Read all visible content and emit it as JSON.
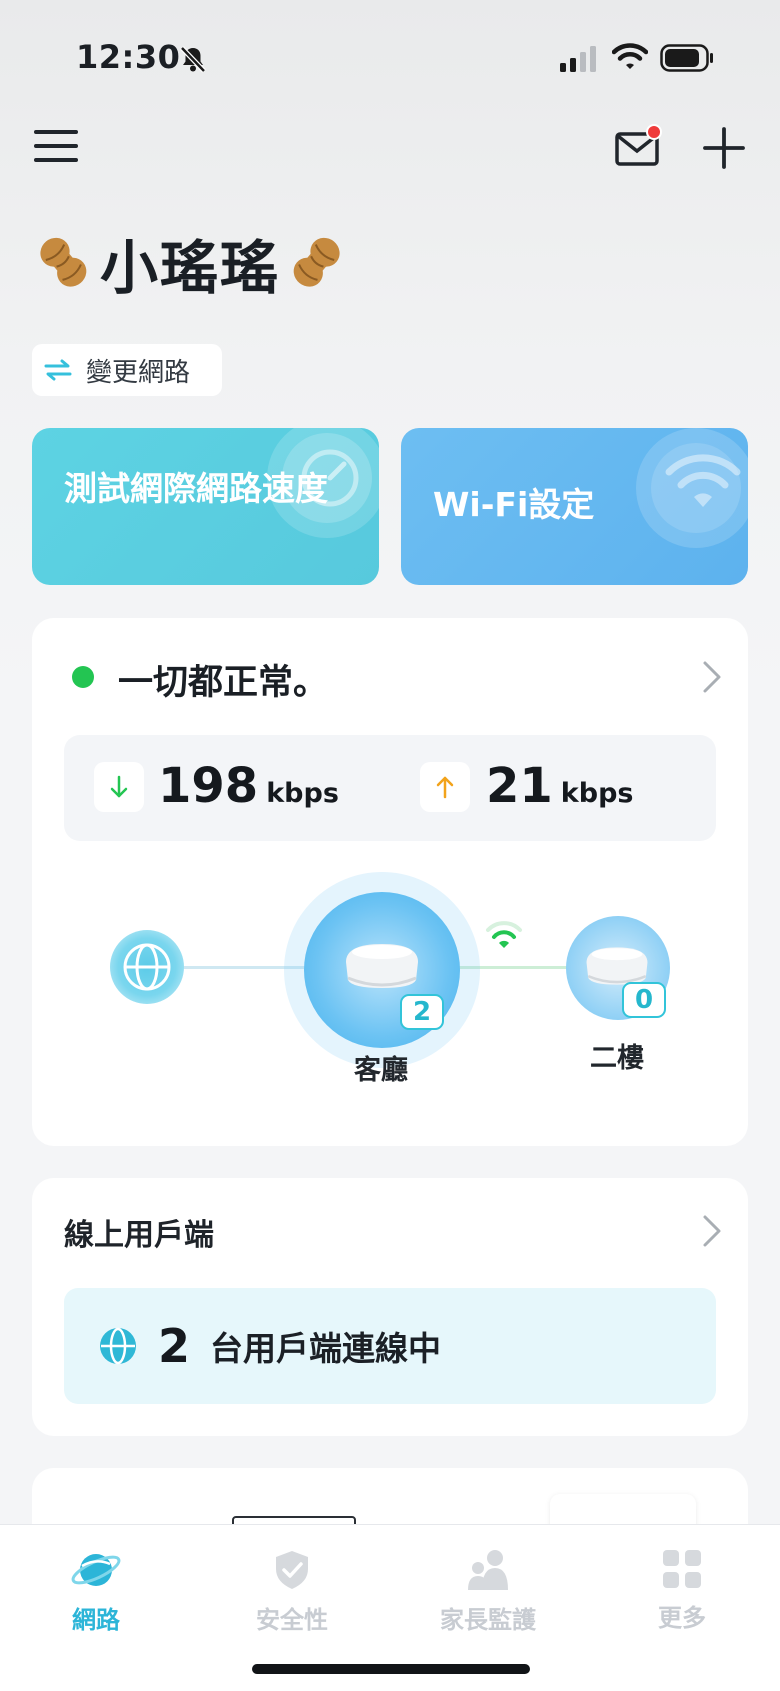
{
  "status_bar": {
    "time": "12:30"
  },
  "header": {
    "title": "小瑤瑤",
    "title_emoji": "🥜"
  },
  "change_network": {
    "label": "變更網路"
  },
  "action_cards": {
    "speed_test": {
      "label": "測試網際網路速度",
      "color": "#5dd3e3"
    },
    "wifi_settings": {
      "label": "Wi-Fi設定",
      "color": "#6dbef2"
    }
  },
  "network_status": {
    "text": "一切都正常。",
    "download": {
      "value": "198",
      "unit": "kbps"
    },
    "upload": {
      "value": "21",
      "unit": "kbps"
    }
  },
  "topology": {
    "nodes": [
      {
        "label": "客廳",
        "clients": "2"
      },
      {
        "label": "二樓",
        "clients": "0"
      }
    ]
  },
  "clients": {
    "title": "線上用戶端",
    "count": "2",
    "summary": "台用戶端連線中"
  },
  "tabs": [
    {
      "label": "網路",
      "icon": "planet-icon",
      "active": true
    },
    {
      "label": "安全性",
      "icon": "shield-icon",
      "active": false
    },
    {
      "label": "家長監護",
      "icon": "family-icon",
      "active": false
    },
    {
      "label": "更多",
      "icon": "grid-icon",
      "active": false
    }
  ],
  "colors": {
    "accent": "#2cb5d8",
    "status_ok": "#23c552",
    "download": "#23c552",
    "upload": "#f2a31b"
  }
}
